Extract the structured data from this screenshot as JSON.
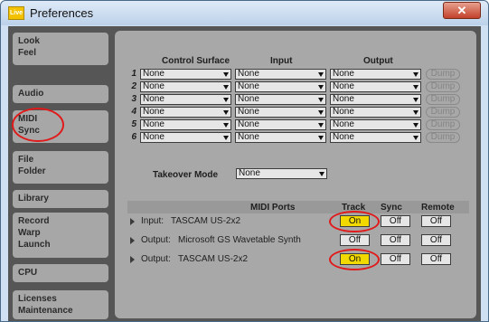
{
  "window": {
    "title": "Preferences",
    "app_icon_text": "Live",
    "close_glyph": "✕"
  },
  "sidebar": {
    "items": [
      {
        "lines": [
          "Look",
          "Feel"
        ]
      },
      {
        "lines": [
          "Audio"
        ]
      },
      {
        "lines": [
          "MIDI",
          "Sync"
        ]
      },
      {
        "lines": [
          "File",
          "Folder"
        ]
      },
      {
        "lines": [
          "Library"
        ]
      },
      {
        "lines": [
          "Record",
          "Warp",
          "Launch"
        ]
      },
      {
        "lines": [
          "CPU"
        ]
      },
      {
        "lines": [
          "Licenses",
          "Maintenance"
        ]
      }
    ]
  },
  "control_surfaces": {
    "headers": {
      "control_surface": "Control Surface",
      "input": "Input",
      "output": "Output"
    },
    "rows": [
      {
        "num": "1",
        "surface": "None",
        "input": "None",
        "output": "None",
        "dump": "Dump"
      },
      {
        "num": "2",
        "surface": "None",
        "input": "None",
        "output": "None",
        "dump": "Dump"
      },
      {
        "num": "3",
        "surface": "None",
        "input": "None",
        "output": "None",
        "dump": "Dump"
      },
      {
        "num": "4",
        "surface": "None",
        "input": "None",
        "output": "None",
        "dump": "Dump"
      },
      {
        "num": "5",
        "surface": "None",
        "input": "None",
        "output": "None",
        "dump": "Dump"
      },
      {
        "num": "6",
        "surface": "None",
        "input": "None",
        "output": "None",
        "dump": "Dump"
      }
    ]
  },
  "takeover": {
    "label": "Takeover Mode",
    "value": "None"
  },
  "midi_ports": {
    "headers": {
      "ports": "MIDI Ports",
      "track": "Track",
      "sync": "Sync",
      "remote": "Remote"
    },
    "rows": [
      {
        "direction": "Input:",
        "name": "TASCAM US-2x2",
        "track": "On",
        "sync": "Off",
        "remote": "Off"
      },
      {
        "direction": "Output:",
        "name": "Microsoft GS Wavetable Synth",
        "track": "Off",
        "sync": "Off",
        "remote": "Off"
      },
      {
        "direction": "Output:",
        "name": "TASCAM US-2x2",
        "track": "On",
        "sync": "Off",
        "remote": "Off"
      }
    ]
  },
  "colors": {
    "track_on": "#f2da00",
    "annotation_ring": "#e01a1a",
    "panel_bg": "#a8a8a8",
    "window_bg": "#565656"
  }
}
